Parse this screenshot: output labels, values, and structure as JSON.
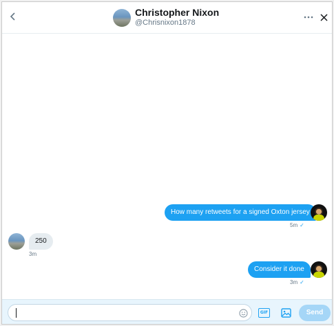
{
  "header": {
    "name": "Christopher Nixon",
    "handle": "@Chrisnixon1878",
    "back_icon": "chevron-left-icon",
    "more_icon": "more-icon",
    "close_icon": "close-icon"
  },
  "messages": [
    {
      "direction": "outgoing",
      "text": "How many retweets for a signed Oxton jersey",
      "time": "5m",
      "read_mark": "✓"
    },
    {
      "direction": "incoming",
      "text": "250",
      "time": "3m"
    },
    {
      "direction": "outgoing",
      "text": "Consider it done",
      "time": "3m",
      "read_mark": "✓"
    }
  ],
  "composer": {
    "placeholder": "",
    "value": "",
    "gif_label": "GIF",
    "send_label": "Send",
    "emoji_icon": "emoji-icon",
    "media_icon": "image-icon"
  },
  "colors": {
    "accent": "#1da1f2",
    "send_disabled": "#a5d6f7",
    "incoming_bubble": "#e6ecf0",
    "composer_bg": "#e8f5fd"
  }
}
